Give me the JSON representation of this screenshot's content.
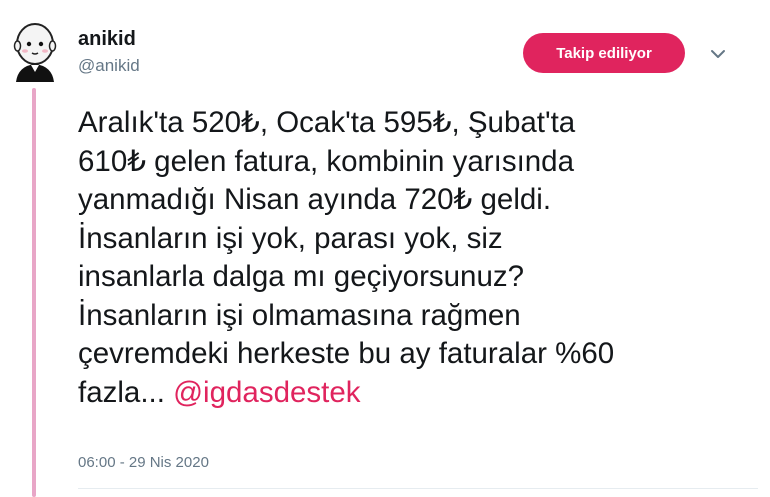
{
  "author": {
    "display_name": "anikid",
    "handle": "@anikid"
  },
  "follow_button": {
    "label": "Takip ediliyor"
  },
  "tweet": {
    "text_lines": "Aralık'ta 520₺, Ocak'ta 595₺, Şubat'ta\n610₺ gelen fatura, kombinin yarısında\nyanmadığı Nisan ayında 720₺ geldi.\nİnsanların işi yok, parası yok, siz\ninsanlarla dalga mı geçiyorsunuz?\nİnsanların işi olmamasına rağmen\nçevremdeki herkeste bu ay faturalar %60\nfazla... ",
    "mention": "@igdasdestek",
    "timestamp": "06:00 - 29 Nis 2020"
  },
  "icons": {
    "avatar": "cartoon-face-avatar",
    "caret": "chevron-down-icon"
  },
  "colors": {
    "accent": "#e0245e",
    "thread_line": "#e8a6c7",
    "secondary_text": "#657786"
  }
}
